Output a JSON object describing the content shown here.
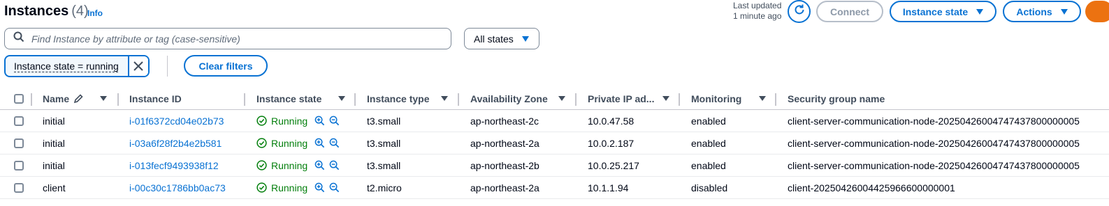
{
  "header": {
    "title": "Instances",
    "count": "(4)",
    "info": "Info",
    "last_updated_line1": "Last updated",
    "last_updated_line2": "1 minute ago",
    "connect": "Connect",
    "instance_state": "Instance state",
    "actions": "Actions"
  },
  "search": {
    "placeholder": "Find Instance by attribute or tag (case-sensitive)"
  },
  "states_filter": {
    "selected": "All states"
  },
  "filter_token": {
    "label": "Instance state = running"
  },
  "clear_filters": "Clear filters",
  "columns": {
    "name": "Name",
    "instance_id": "Instance ID",
    "instance_state": "Instance state",
    "instance_type": "Instance type",
    "availability_zone": "Availability Zone",
    "private_ip": "Private IP ad...",
    "monitoring": "Monitoring",
    "security_group": "Security group name"
  },
  "rows": [
    {
      "name": "initial",
      "id": "i-01f6372cd04e02b73",
      "state": "Running",
      "type": "t3.small",
      "az": "ap-northeast-2c",
      "ip": "10.0.47.58",
      "monitoring": "enabled",
      "sg": "client-server-communication-node-20250426004747437800000005"
    },
    {
      "name": "initial",
      "id": "i-03a6f28f2b4e2b581",
      "state": "Running",
      "type": "t3.small",
      "az": "ap-northeast-2a",
      "ip": "10.0.2.187",
      "monitoring": "enabled",
      "sg": "client-server-communication-node-20250426004747437800000005"
    },
    {
      "name": "initial",
      "id": "i-013fecf9493938f12",
      "state": "Running",
      "type": "t3.small",
      "az": "ap-northeast-2b",
      "ip": "10.0.25.217",
      "monitoring": "enabled",
      "sg": "client-server-communication-node-20250426004747437800000005"
    },
    {
      "name": "client",
      "id": "i-00c30c1786bb0ac73",
      "state": "Running",
      "type": "t2.micro",
      "az": "ap-northeast-2a",
      "ip": "10.1.1.94",
      "monitoring": "disabled",
      "sg": "client-20250426004425966600000001"
    }
  ],
  "colors": {
    "accent": "#0972d3",
    "success": "#037f0c",
    "brand_orange": "#ec7211"
  }
}
